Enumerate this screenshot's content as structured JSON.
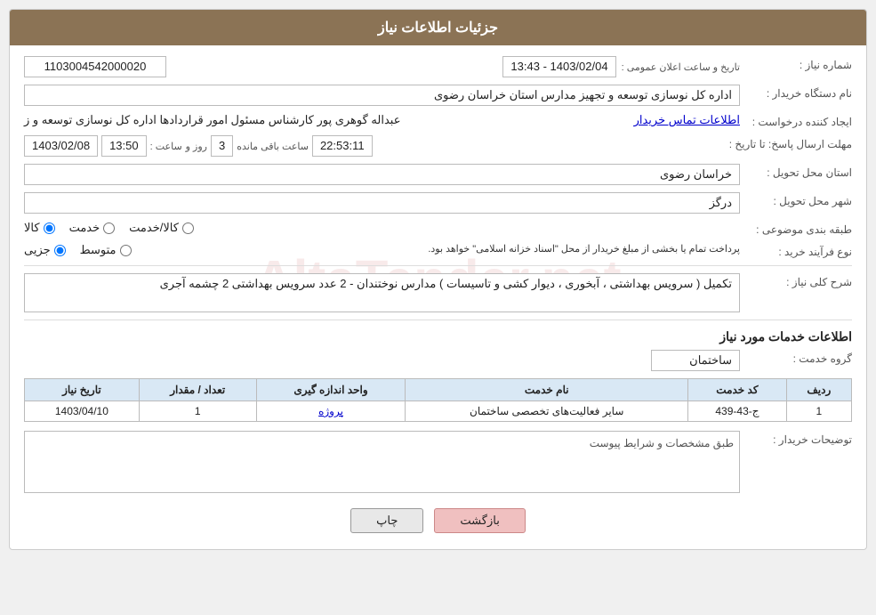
{
  "header": {
    "title": "جزئیات اطلاعات نیاز"
  },
  "fields": {
    "need_number_label": "شماره نیاز :",
    "need_number_value": "1103004542000020",
    "buyer_org_label": "نام دستگاه خریدار :",
    "buyer_org_value": "اداره کل نوسازی  توسعه و تجهیز مدارس استان خراسان رضوی",
    "creator_label": "ایجاد کننده درخواست :",
    "creator_value": "عبداله گوهری پور کارشناس مسئول امور قراردادها  اداره کل نوسازی  توسعه و ز",
    "creator_link": "اطلاعات تماس خریدار",
    "deadline_label": "مهلت ارسال پاسخ: تا تاریخ :",
    "deadline_date": "1403/02/08",
    "deadline_time_label": "ساعت :",
    "deadline_time": "13:50",
    "deadline_day_label": "روز و",
    "deadline_days": "3",
    "deadline_remaining_label": "ساعت باقی مانده",
    "deadline_remaining": "22:53:11",
    "announce_label": "تاریخ و ساعت اعلان عمومی :",
    "announce_value": "1403/02/04 - 13:43",
    "province_label": "استان محل تحویل :",
    "province_value": "خراسان رضوی",
    "city_label": "شهر محل تحویل :",
    "city_value": "درگز",
    "category_label": "طبقه بندی موضوعی :",
    "category_options": [
      "کالا",
      "خدمت",
      "کالا/خدمت"
    ],
    "category_selected": "کالا",
    "process_label": "نوع فرآیند خرید :",
    "process_options": [
      "جزیی",
      "متوسط"
    ],
    "process_note": "پرداخت تمام یا بخشی از مبلغ خریدار از محل \"اسناد خزانه اسلامی\" خواهد بود.",
    "need_desc_label": "شرح کلی نیاز :",
    "need_desc_value": "تکمیل ( سرویس بهداشتی ، آبخوری ، دیوار کشی و تاسیسات ) مدارس نوختندان - 2 عدد سرویس بهداشتی 2 چشمه آجری",
    "services_section_label": "اطلاعات خدمات مورد نیاز",
    "service_group_label": "گروه خدمت :",
    "service_group_value": "ساختمان",
    "table": {
      "headers": [
        "ردیف",
        "کد خدمت",
        "نام خدمت",
        "واحد اندازه گیری",
        "تعداد / مقدار",
        "تاریخ نیاز"
      ],
      "rows": [
        {
          "row": "1",
          "code": "ج-43-439",
          "name": "سایر فعالیت‌های تخصصی ساختمان",
          "unit": "پروژه",
          "qty": "1",
          "date": "1403/04/10"
        }
      ]
    },
    "buyer_desc_label": "توضیحات خریدار :",
    "buyer_desc_value": "طبق مشخصات و شرایط پیوست"
  },
  "buttons": {
    "print_label": "چاپ",
    "back_label": "بازگشت"
  }
}
